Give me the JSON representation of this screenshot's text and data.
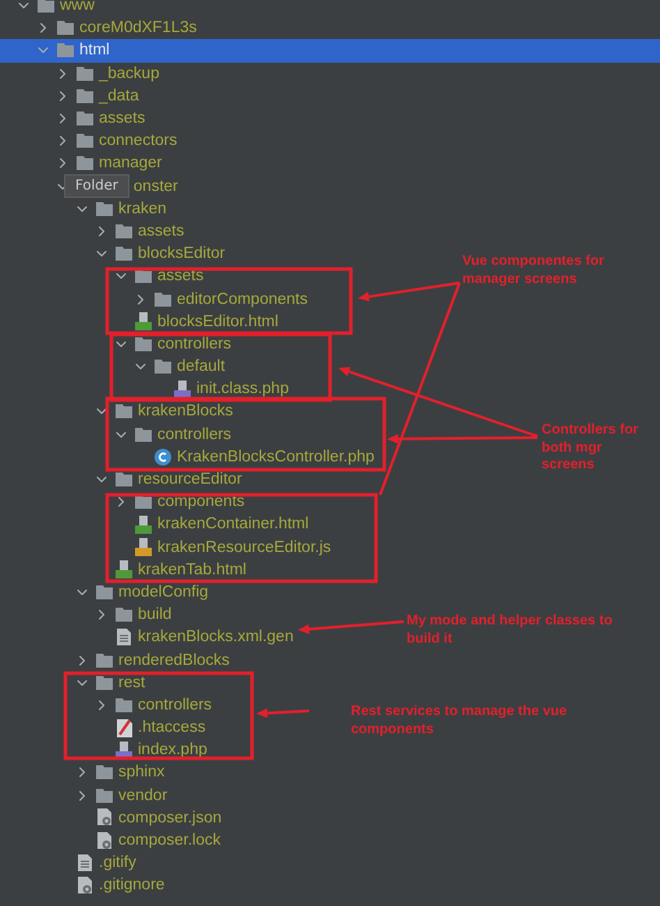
{
  "tree": [
    {
      "name": "www",
      "kind": "folder",
      "expanded": true,
      "selected": false,
      "children": [
        {
          "name": "coreM0dXF1L3s",
          "kind": "folder",
          "expanded": false,
          "selected": false
        },
        {
          "name": "html",
          "kind": "folder",
          "expanded": true,
          "selected": true,
          "children": [
            {
              "name": "_backup",
              "kind": "folder",
              "expanded": false,
              "selected": false
            },
            {
              "name": "_data",
              "kind": "folder",
              "expanded": false,
              "selected": false
            },
            {
              "name": "assets",
              "kind": "folder",
              "expanded": false,
              "selected": false
            },
            {
              "name": "connectors",
              "kind": "folder",
              "expanded": false,
              "selected": false
            },
            {
              "name": "manager",
              "kind": "folder",
              "expanded": false,
              "selected": false
            },
            {
              "name": "onster",
              "kind": "folder",
              "expanded": true,
              "selected": false,
              "tooltip": "Folder",
              "children": [
                {
                  "name": "kraken",
                  "kind": "folder",
                  "expanded": true,
                  "selected": false,
                  "children": [
                    {
                      "name": "assets",
                      "kind": "folder",
                      "expanded": false,
                      "selected": false
                    },
                    {
                      "name": "blocksEditor",
                      "kind": "folder",
                      "expanded": true,
                      "selected": false,
                      "children": [
                        {
                          "name": "assets",
                          "kind": "folder",
                          "expanded": true,
                          "selected": false,
                          "children": [
                            {
                              "name": "editorComponents",
                              "kind": "folder",
                              "expanded": false,
                              "selected": false
                            }
                          ]
                        },
                        {
                          "name": "blocksEditor.html",
                          "kind": "html",
                          "selected": false
                        },
                        {
                          "name": "controllers",
                          "kind": "folder",
                          "expanded": true,
                          "selected": false,
                          "children": [
                            {
                              "name": "default",
                              "kind": "folder",
                              "expanded": true,
                              "selected": false,
                              "children": [
                                {
                                  "name": "init.class.php",
                                  "kind": "php",
                                  "selected": false
                                }
                              ]
                            }
                          ]
                        }
                      ]
                    },
                    {
                      "name": "krakenBlocks",
                      "kind": "folder",
                      "expanded": true,
                      "selected": false,
                      "children": [
                        {
                          "name": "controllers",
                          "kind": "folder",
                          "expanded": true,
                          "selected": false,
                          "children": [
                            {
                              "name": "KrakenBlocksController.php",
                              "kind": "class",
                              "selected": false
                            }
                          ]
                        }
                      ]
                    },
                    {
                      "name": "resourceEditor",
                      "kind": "folder",
                      "expanded": true,
                      "selected": false,
                      "children": [
                        {
                          "name": "components",
                          "kind": "folder",
                          "expanded": false,
                          "selected": false
                        },
                        {
                          "name": "krakenContainer.html",
                          "kind": "html",
                          "selected": false
                        },
                        {
                          "name": "krakenResourceEditor.js",
                          "kind": "js",
                          "selected": false
                        }
                      ]
                    },
                    {
                      "name": "krakenTab.html",
                      "kind": "html",
                      "selected": false
                    }
                  ]
                },
                {
                  "name": "modelConfig",
                  "kind": "folder",
                  "expanded": true,
                  "selected": false,
                  "children": [
                    {
                      "name": "build",
                      "kind": "folder",
                      "expanded": false,
                      "selected": false
                    },
                    {
                      "name": "krakenBlocks.xml.gen",
                      "kind": "text",
                      "selected": false
                    }
                  ]
                },
                {
                  "name": "renderedBlocks",
                  "kind": "folder",
                  "expanded": false,
                  "selected": false
                },
                {
                  "name": "rest",
                  "kind": "folder",
                  "expanded": true,
                  "selected": false,
                  "children": [
                    {
                      "name": "controllers",
                      "kind": "folder",
                      "expanded": false,
                      "selected": false
                    },
                    {
                      "name": ".htaccess",
                      "kind": "htaccess",
                      "selected": false
                    },
                    {
                      "name": "index.php",
                      "kind": "php",
                      "selected": false
                    }
                  ]
                },
                {
                  "name": "sphinx",
                  "kind": "folder",
                  "expanded": false,
                  "selected": false
                },
                {
                  "name": "vendor",
                  "kind": "folder",
                  "expanded": false,
                  "selected": false
                },
                {
                  "name": "composer.json",
                  "kind": "config",
                  "selected": false
                },
                {
                  "name": "composer.lock",
                  "kind": "config",
                  "selected": false
                }
              ]
            },
            {
              "name": ".gitify",
              "kind": "text",
              "selected": false
            },
            {
              "name": ".gitignore",
              "kind": "config",
              "selected": false
            }
          ]
        }
      ]
    }
  ],
  "annotations": [
    {
      "text": "Vue componentes for manager screens"
    },
    {
      "text": "Controllers for both mgr screens"
    },
    {
      "text": "My mode and helper classes to build it"
    },
    {
      "text": "Rest services to manage the vue components"
    }
  ]
}
